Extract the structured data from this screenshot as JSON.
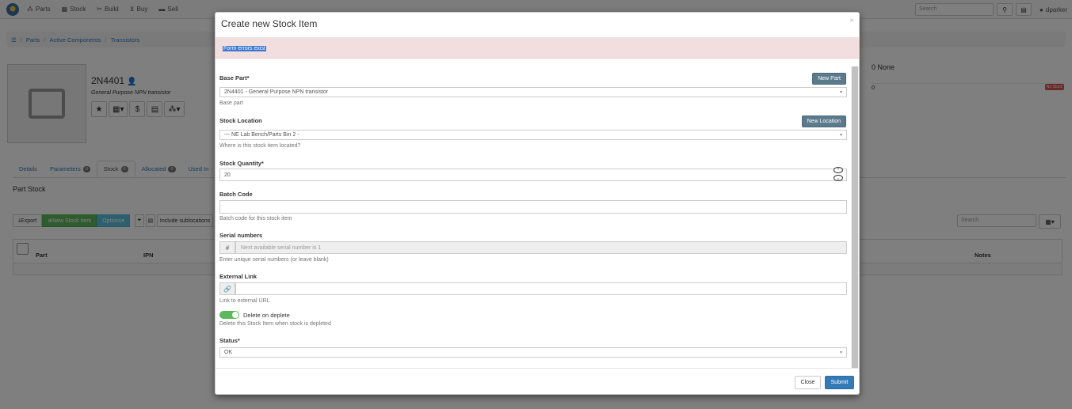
{
  "navbar": {
    "items": [
      {
        "label": "Parts",
        "icon": "shapes-icon"
      },
      {
        "label": "Stock",
        "icon": "boxes-icon"
      },
      {
        "label": "Build",
        "icon": "tools-icon"
      },
      {
        "label": "Buy",
        "icon": "cart-icon"
      },
      {
        "label": "Sell",
        "icon": "truck-icon"
      }
    ],
    "search_placeholder": "Search",
    "user": "dparker"
  },
  "breadcrumb": [
    "Parts",
    "Active Components",
    "Transistors"
  ],
  "part": {
    "name": "2N4401",
    "description": "General Purpose NPN transistor"
  },
  "stats": {
    "header": "0 None",
    "row_value": "0",
    "badge": "No Stock"
  },
  "tabs": [
    {
      "label": "Details",
      "count": ""
    },
    {
      "label": "Parameters",
      "count": "0"
    },
    {
      "label": "Stock",
      "count": "0"
    },
    {
      "label": "Allocated",
      "count": "0"
    },
    {
      "label": "Used In",
      "count": ""
    }
  ],
  "section_title": "Part Stock",
  "toolbar": {
    "export": "Export",
    "new_stock": "New Stock Item",
    "options": "Options",
    "include_sublocations": "Include sublocations",
    "search_placeholder": "Search"
  },
  "table": {
    "columns": [
      "Part",
      "IPN",
      "Notes"
    ]
  },
  "modal": {
    "title": "Create new Stock Item",
    "close_x": "×",
    "error": "Form errors exist",
    "fields": {
      "base_part": {
        "label": "Base Part*",
        "value": "2N4401 - General Purpose NPN transistor",
        "help": "Base part",
        "button": "New Part"
      },
      "stock_location": {
        "label": "Stock Location",
        "value": "--- NE Lab Bench/Parts Bin 2 -",
        "help": "Where is this stock item located?",
        "button": "New Location"
      },
      "quantity": {
        "label": "Stock Quantity*",
        "value": "20"
      },
      "batch": {
        "label": "Batch Code",
        "value": "",
        "help": "Batch code for this stock item"
      },
      "serial": {
        "label": "Serial numbers",
        "addon": "#",
        "placeholder": "Next available serial number is 1",
        "help": "Enter unique serial numbers (or leave blank)"
      },
      "link": {
        "label": "External Link",
        "help": "Link to external URL"
      },
      "delete_on_deplete": {
        "label": "Delete on deplete",
        "help": "Delete this Stock Item when stock is depleted",
        "checked": true
      },
      "status": {
        "label": "Status*",
        "value": "OK"
      }
    },
    "footer": {
      "close": "Close",
      "submit": "Submit"
    }
  }
}
